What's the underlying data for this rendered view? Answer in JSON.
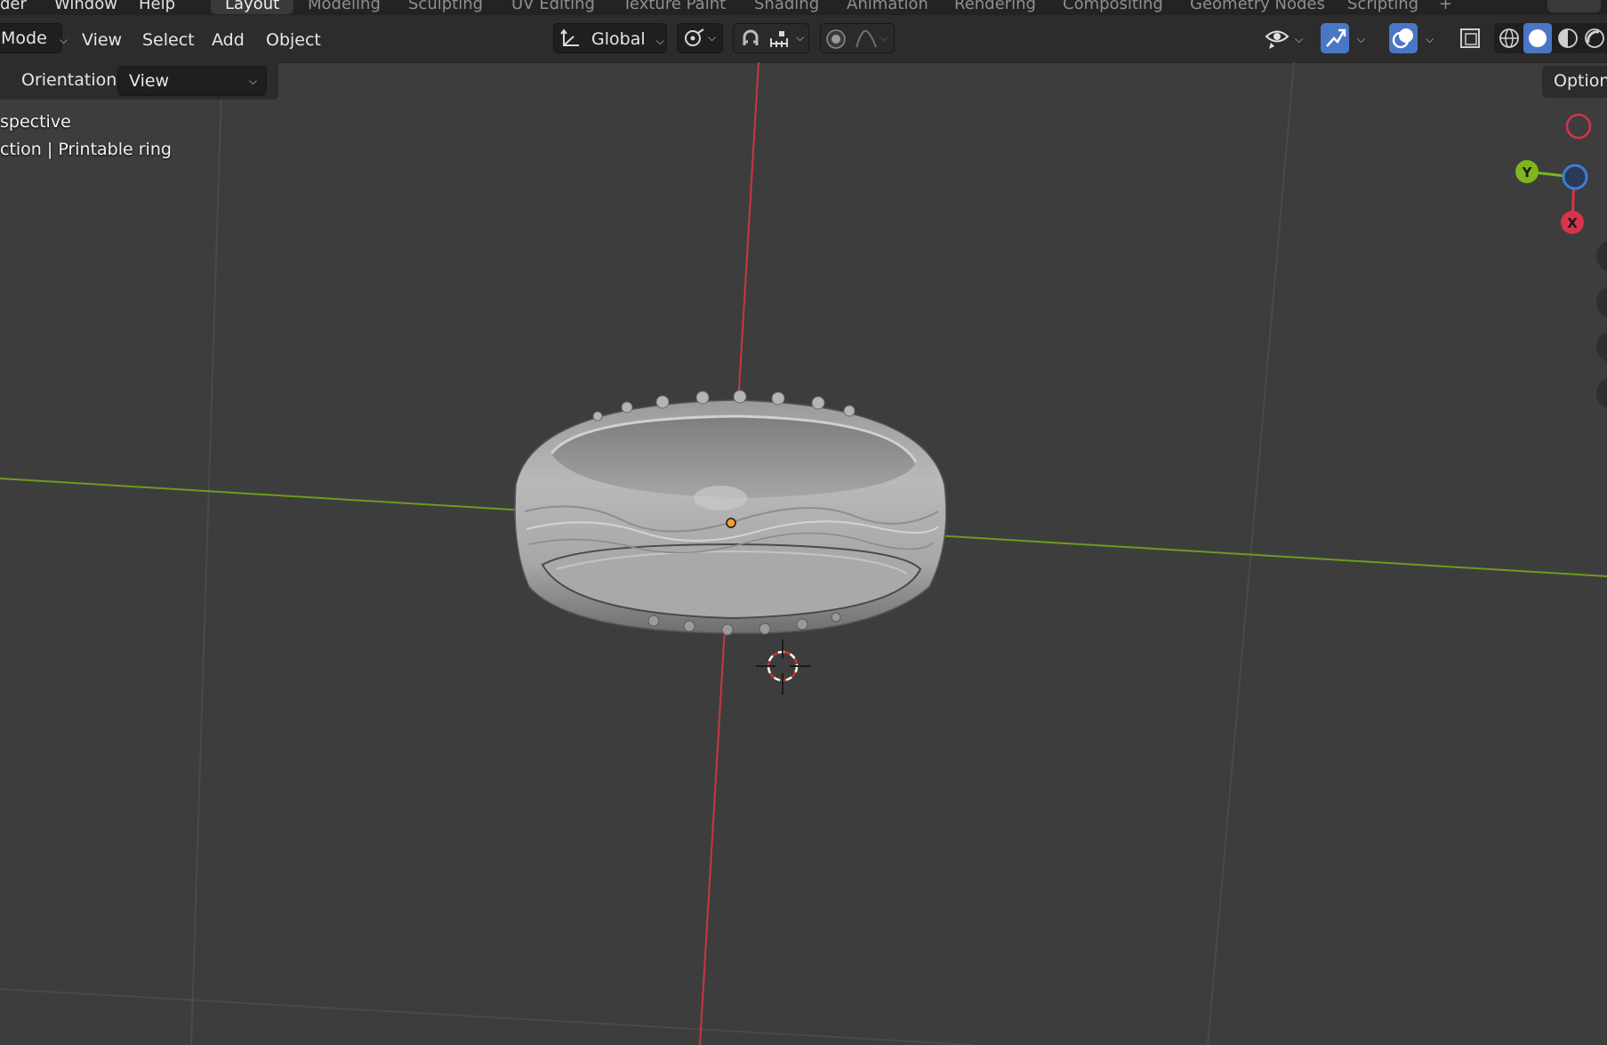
{
  "topbar": {
    "menus": [
      "der",
      "Window",
      "Help"
    ],
    "workspace_tabs": [
      "Layout",
      "Modeling",
      "Sculpting",
      "UV Editing",
      "Texture Paint",
      "Shading",
      "Animation",
      "Rendering",
      "Compositing",
      "Geometry Nodes",
      "Scripting"
    ],
    "add_tab": "+"
  },
  "header": {
    "mode_label": "Mode",
    "view_menu": "View",
    "select_menu": "Select",
    "add_menu": "Add",
    "object_menu": "Object",
    "transform_orientation": "Global"
  },
  "tool_settings": {
    "orientation_label": "Orientation:",
    "orientation_value": "View",
    "options_label": "Option"
  },
  "viewport": {
    "view_name": "spective",
    "collection_info": "ction | Printable ring"
  },
  "gizmo": {
    "y_label": "Y",
    "x_label": "X",
    "colors": {
      "x": "#d7334a",
      "y": "#7fb51d",
      "z": "#3c7fd8"
    }
  },
  "colors": {
    "x_axis_line": "#c8373f",
    "y_axis_line": "#6f9a1e",
    "accent_blue": "#4a76c6",
    "origin_dot": "#f0a030"
  }
}
